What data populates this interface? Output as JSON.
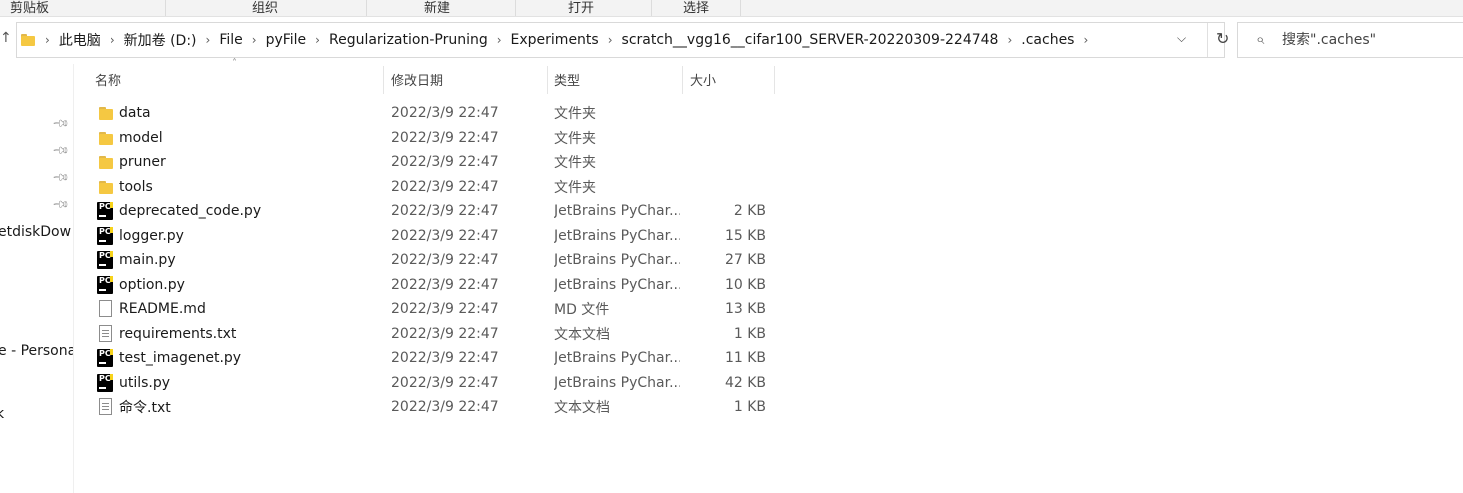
{
  "ribbon": {
    "groups": [
      "剪贴板",
      "组织",
      "新建",
      "打开",
      "选择"
    ]
  },
  "address": {
    "up_icon": "up-arrow-icon",
    "crumbs": [
      "此电脑",
      "新加卷 (D:)",
      "File",
      "pyFile",
      "Regularization-Pruning",
      "Experiments",
      "scratch__vgg16__cifar100_SERVER-20220309-224748",
      ".caches"
    ]
  },
  "search": {
    "placeholder": "搜索\".caches\""
  },
  "nav": {
    "texts": [
      "etdiskDow",
      "e - Persona",
      "k"
    ]
  },
  "columns": {
    "name": "名称",
    "date": "修改日期",
    "type": "类型",
    "size": "大小"
  },
  "files": [
    {
      "name": "data",
      "date": "2022/3/9 22:47",
      "type": "文件夹",
      "size": "",
      "icon": "folder-icon"
    },
    {
      "name": "model",
      "date": "2022/3/9 22:47",
      "type": "文件夹",
      "size": "",
      "icon": "folder-icon"
    },
    {
      "name": "pruner",
      "date": "2022/3/9 22:47",
      "type": "文件夹",
      "size": "",
      "icon": "folder-icon"
    },
    {
      "name": "tools",
      "date": "2022/3/9 22:47",
      "type": "文件夹",
      "size": "",
      "icon": "folder-icon"
    },
    {
      "name": "deprecated_code.py",
      "date": "2022/3/9 22:47",
      "type": "JetBrains PyChar...",
      "size": "2 KB",
      "icon": "pycharm-file-icon"
    },
    {
      "name": "logger.py",
      "date": "2022/3/9 22:47",
      "type": "JetBrains PyChar...",
      "size": "15 KB",
      "icon": "pycharm-file-icon"
    },
    {
      "name": "main.py",
      "date": "2022/3/9 22:47",
      "type": "JetBrains PyChar...",
      "size": "27 KB",
      "icon": "pycharm-file-icon"
    },
    {
      "name": "option.py",
      "date": "2022/3/9 22:47",
      "type": "JetBrains PyChar...",
      "size": "10 KB",
      "icon": "pycharm-file-icon"
    },
    {
      "name": "README.md",
      "date": "2022/3/9 22:47",
      "type": "MD 文件",
      "size": "13 KB",
      "icon": "document-icon"
    },
    {
      "name": "requirements.txt",
      "date": "2022/3/9 22:47",
      "type": "文本文档",
      "size": "1 KB",
      "icon": "text-file-icon"
    },
    {
      "name": "test_imagenet.py",
      "date": "2022/3/9 22:47",
      "type": "JetBrains PyChar...",
      "size": "11 KB",
      "icon": "pycharm-file-icon"
    },
    {
      "name": "utils.py",
      "date": "2022/3/9 22:47",
      "type": "JetBrains PyChar...",
      "size": "42 KB",
      "icon": "pycharm-file-icon"
    },
    {
      "name": "命令.txt",
      "date": "2022/3/9 22:47",
      "type": "文本文档",
      "size": "1 KB",
      "icon": "text-file-icon"
    }
  ]
}
